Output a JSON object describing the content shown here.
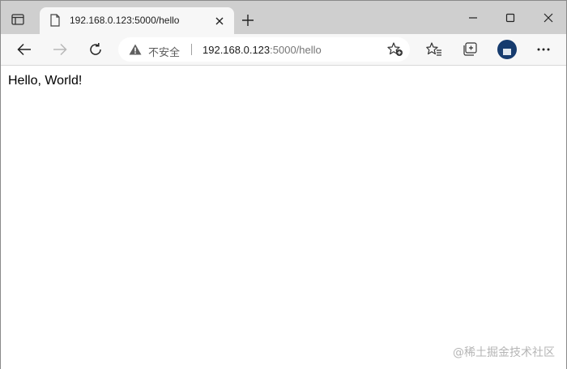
{
  "tab": {
    "title": "192.168.0.123:5000/hello",
    "favicon": "page-icon"
  },
  "address_bar": {
    "security_label": "不安全",
    "url_host": "192.168.0.123",
    "url_rest": ":5000/hello"
  },
  "page": {
    "content": "Hello, World!"
  },
  "watermark": "@稀土掘金技术社区",
  "colors": {
    "titlebar": "#cfcfcf",
    "toolbar": "#f7f7f7",
    "avatar": "#163b6e"
  }
}
